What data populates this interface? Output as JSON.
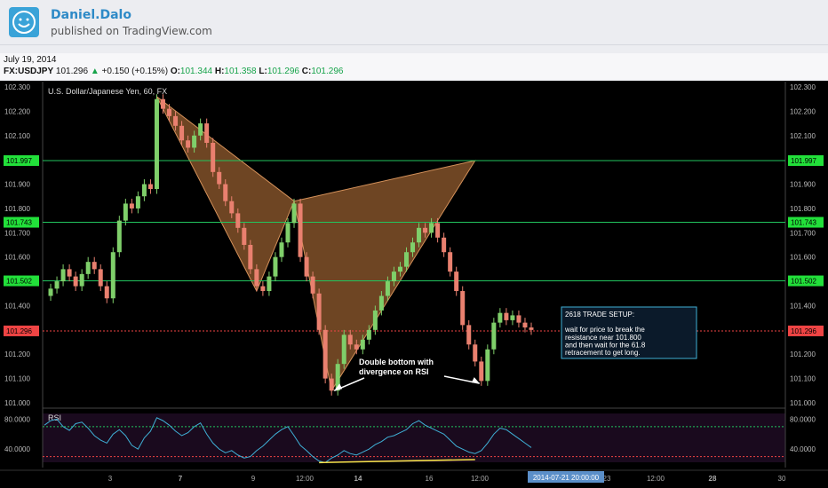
{
  "header": {
    "author": "Daniel.Dalo",
    "published": "published on TradingView.com"
  },
  "info": {
    "date": "July 19, 2014",
    "symbol": "FX:USDJPY",
    "last": "101.296",
    "change": "+0.150 (+0.15%)",
    "open_label": "O:",
    "open": "101.344",
    "high_label": "H:",
    "high": "101.358",
    "low_label": "L:",
    "low": "101.296",
    "close_label": "C:",
    "close": "101.296"
  },
  "chart_data": [
    {
      "type": "candlestick",
      "title": "U.S. Dollar/Japanese Yen, 60, FX",
      "ylim": [
        101.0,
        102.3
      ],
      "y_ticks": [
        "102.300",
        "102.200",
        "102.100",
        "102.000",
        "101.900",
        "101.800",
        "101.700",
        "101.600",
        "101.500",
        "101.400",
        "101.300",
        "101.200",
        "101.100",
        "101.000"
      ],
      "x_ticks": [
        "3",
        "7",
        "9",
        "12:00",
        "14",
        "16",
        "12:00",
        "23",
        "12:00",
        "28",
        "30"
      ],
      "horizontal_levels": [
        {
          "label": "101.997",
          "value": 101.997,
          "color": "#22c55e"
        },
        {
          "label": "101.743",
          "value": 101.743,
          "color": "#22c55e"
        },
        {
          "label": "101.502",
          "value": 101.502,
          "color": "#22c55e"
        },
        {
          "label": "101.296",
          "value": 101.296,
          "color": "#ef4444"
        }
      ],
      "price_path": [
        [
          0,
          101.44
        ],
        [
          1,
          101.47
        ],
        [
          2,
          101.5
        ],
        [
          3,
          101.55
        ],
        [
          4,
          101.52
        ],
        [
          5,
          101.48
        ],
        [
          6,
          101.53
        ],
        [
          7,
          101.58
        ],
        [
          8,
          101.55
        ],
        [
          9,
          101.48
        ],
        [
          10,
          101.43
        ],
        [
          11,
          101.62
        ],
        [
          12,
          101.75
        ],
        [
          13,
          101.82
        ],
        [
          14,
          101.8
        ],
        [
          15,
          101.85
        ],
        [
          16,
          101.9
        ],
        [
          17,
          101.88
        ],
        [
          18,
          102.25
        ],
        [
          19,
          102.21
        ],
        [
          20,
          102.18
        ],
        [
          21,
          102.14
        ],
        [
          22,
          102.08
        ],
        [
          23,
          102.05
        ],
        [
          24,
          102.1
        ],
        [
          25,
          102.15
        ],
        [
          26,
          102.07
        ],
        [
          27,
          101.95
        ],
        [
          28,
          101.9
        ],
        [
          29,
          101.83
        ],
        [
          30,
          101.78
        ],
        [
          31,
          101.72
        ],
        [
          32,
          101.65
        ],
        [
          33,
          101.55
        ],
        [
          34,
          101.48
        ],
        [
          35,
          101.46
        ],
        [
          36,
          101.52
        ],
        [
          37,
          101.6
        ],
        [
          38,
          101.66
        ],
        [
          39,
          101.74
        ],
        [
          40,
          101.82
        ],
        [
          41,
          101.6
        ],
        [
          42,
          101.52
        ],
        [
          43,
          101.45
        ],
        [
          44,
          101.3
        ],
        [
          45,
          101.1
        ],
        [
          46,
          101.05
        ],
        [
          47,
          101.16
        ],
        [
          48,
          101.28
        ],
        [
          49,
          101.24
        ],
        [
          50,
          101.22
        ],
        [
          51,
          101.26
        ],
        [
          52,
          101.3
        ],
        [
          53,
          101.38
        ],
        [
          54,
          101.44
        ],
        [
          55,
          101.5
        ],
        [
          56,
          101.54
        ],
        [
          57,
          101.56
        ],
        [
          58,
          101.62
        ],
        [
          59,
          101.66
        ],
        [
          60,
          101.72
        ],
        [
          61,
          101.7
        ],
        [
          62,
          101.74
        ],
        [
          63,
          101.68
        ],
        [
          64,
          101.62
        ],
        [
          65,
          101.54
        ],
        [
          66,
          101.46
        ],
        [
          67,
          101.32
        ],
        [
          68,
          101.24
        ],
        [
          69,
          101.17
        ],
        [
          70,
          101.09
        ],
        [
          71,
          101.22
        ],
        [
          72,
          101.33
        ],
        [
          73,
          101.37
        ],
        [
          74,
          101.34
        ],
        [
          75,
          101.36
        ],
        [
          76,
          101.33
        ],
        [
          77,
          101.31
        ],
        [
          78,
          101.3
        ]
      ],
      "pattern": {
        "X": [
          18,
          102.26
        ],
        "A": [
          40,
          101.83
        ],
        "B": [
          45,
          101.05
        ],
        "C": [
          69,
          101.997
        ],
        "left": [
          [
            18,
            102.26
          ],
          [
            40,
            101.83
          ],
          [
            34,
            101.46
          ]
        ],
        "right": [
          [
            40,
            101.83
          ],
          [
            46,
            101.05
          ],
          [
            69,
            101.997
          ]
        ]
      },
      "annotations": [
        {
          "id": "double_bottom",
          "text_line1": "Double bottom with",
          "text_line2": "divergence on RSI"
        },
        {
          "id": "setup",
          "title": "2618 TRADE SETUP:",
          "line1": "wait for price to break the",
          "line2": "resistance near 101.800",
          "line3": "and then wait for the 61.8",
          "line4": "retracement to get long."
        }
      ],
      "time_cursor": "2014-07-21 20:00:00"
    },
    {
      "type": "line",
      "title": "RSI",
      "ylim": [
        20,
        90
      ],
      "y_ticks": [
        "80.0000",
        "40.0000"
      ],
      "levels": [
        70,
        30
      ],
      "values": [
        72,
        78,
        80,
        70,
        65,
        74,
        76,
        68,
        58,
        52,
        48,
        60,
        66,
        58,
        45,
        40,
        55,
        64,
        82,
        78,
        72,
        64,
        58,
        62,
        70,
        75,
        60,
        48,
        40,
        35,
        38,
        32,
        28,
        30,
        38,
        44,
        52,
        60,
        66,
        70,
        58,
        45,
        38,
        30,
        24,
        22,
        28,
        32,
        38,
        34,
        32,
        36,
        40,
        46,
        50,
        56,
        58,
        62,
        66,
        74,
        78,
        72,
        68,
        64,
        60,
        52,
        44,
        40,
        36,
        34,
        38,
        48,
        60,
        68,
        66,
        60,
        54,
        48,
        42
      ],
      "divergence": {
        "from": [
          44,
          22
        ],
        "to": [
          69,
          26
        ]
      }
    }
  ]
}
